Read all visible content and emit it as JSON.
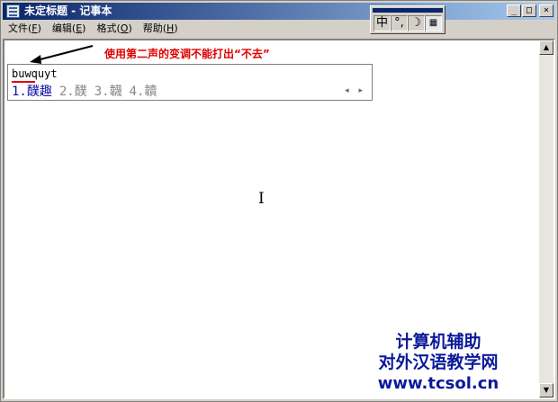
{
  "window": {
    "title": "未定标题 - 记事本",
    "buttons": {
      "minimize": "_",
      "maximize": "□",
      "close": "×"
    }
  },
  "menu": [
    {
      "label": "文件",
      "accel": "F"
    },
    {
      "label": "编辑",
      "accel": "E"
    },
    {
      "label": "格式",
      "accel": "O"
    },
    {
      "label": "帮助",
      "accel": "H"
    }
  ],
  "ime_bar": {
    "mode": "中",
    "punct": "°,",
    "width": "☽",
    "keyboard": "▦"
  },
  "annotation": "使用第二声的变调不能打出“不去”",
  "candidate": {
    "input": "buwquyt",
    "items": [
      "1.醭趣",
      "2.醭",
      "3.韤",
      "4.韥"
    ],
    "nav": "◂ ▸"
  },
  "scroll": {
    "up": "▲",
    "down": "▼"
  },
  "cursor_glyph": "I",
  "watermark": {
    "line1": "计算机辅助",
    "line2": "对外汉语教学网",
    "line3": "www.tcsol.cn"
  },
  "colors": {
    "titlebar_start": "#0a246a",
    "titlebar_end": "#a6caf0",
    "annotation": "#e00000",
    "candidate_selected": "#1010a0",
    "watermark": "#0b1a9a"
  }
}
